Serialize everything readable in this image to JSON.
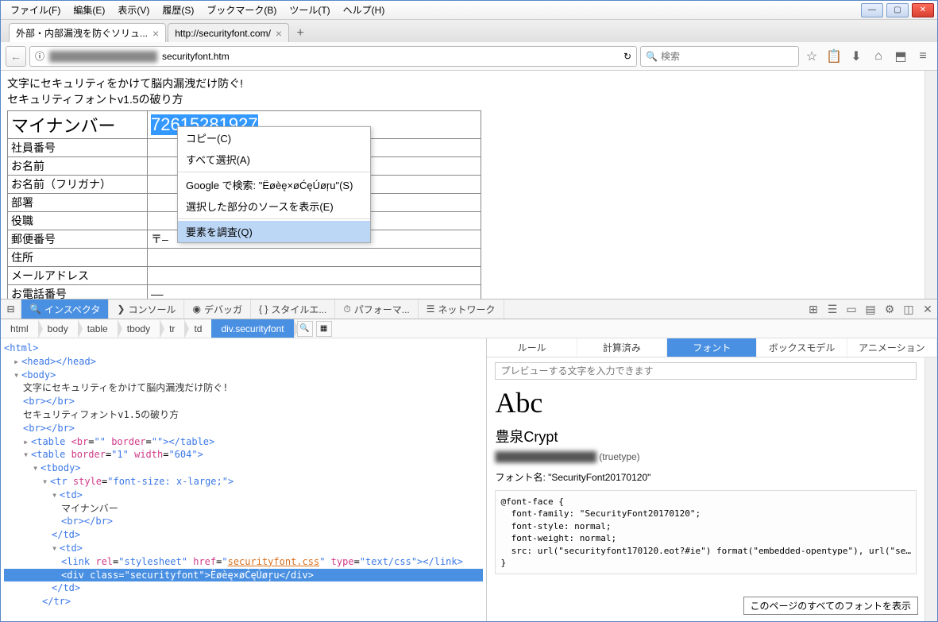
{
  "menubar": [
    "ファイル(F)",
    "編集(E)",
    "表示(V)",
    "履歴(S)",
    "ブックマーク(B)",
    "ツール(T)",
    "ヘルプ(H)"
  ],
  "winbtns": {
    "min": "—",
    "max": "▢",
    "close": "✕"
  },
  "tabs": [
    {
      "title": "外部・内部漏洩を防ぐソリュ...",
      "close": "×"
    },
    {
      "title": "http://securityfont.com/",
      "close": "×"
    }
  ],
  "tabadd": "+",
  "urlbar": {
    "back": "←",
    "info": "ⓘ",
    "blurred": "████████████████",
    "path": "securityfont.htm",
    "reload": "↻",
    "search_icon": "🔍",
    "search_ph": "検索",
    "icons": [
      "☆",
      "📋",
      "⬇",
      "⌂",
      "⬒",
      "≡"
    ]
  },
  "page": {
    "line1": "文字にセキュリティをかけて脳内漏洩だけ防ぐ!",
    "line2": "セキュリティフォントv1.5の破り方",
    "selected": "72615281927",
    "rows": [
      [
        "マイナンバー",
        ""
      ],
      [
        "社員番号",
        ""
      ],
      [
        "お名前",
        ""
      ],
      [
        "お名前（フリガナ）",
        ""
      ],
      [
        "部署",
        ""
      ],
      [
        "役職",
        ""
      ],
      [
        "郵便番号",
        "〒–"
      ],
      [
        "住所",
        ""
      ],
      [
        "メールアドレス",
        ""
      ],
      [
        "お電話番号",
        "––"
      ]
    ]
  },
  "ctx": [
    "コピー(C)",
    "すべて選択(A)",
    "",
    "Google で検索: \"Ëøèę×øĆęÚøŗu\"(S)",
    "選択した部分のソースを表示(E)",
    "",
    "要素を調査(Q)"
  ],
  "devtabs": [
    "インスペクタ",
    "コンソール",
    "デバッガ",
    "スタイルエ...",
    "パフォーマ...",
    "ネットワーク"
  ],
  "devicons": [
    "⊞",
    "☰",
    "▭",
    "▤",
    "⚙",
    "◫",
    "✕"
  ],
  "crumbs": [
    "html",
    "body",
    "table",
    "tbody",
    "tr",
    "td",
    "div.securityfont"
  ],
  "dom": {
    "html": "<html>",
    "head": "<head></head>",
    "body": "<body>",
    "txt1": "文字にセキュリティをかけて脳内漏洩だけ防ぐ!",
    "br": "<br></br>",
    "txt2": "セキュリティフォントv1.5の破り方",
    "table1": "<table <br=\"\" border=\"\"></table>",
    "table2_open": "<table",
    "table2_attr": " border=\"1\" width=\"604\">",
    "tbody": "<tbody>",
    "tr": "<tr style=\"font-size: x-large;\">",
    "td": "<td>",
    "txt3": "マイナンバー",
    "tdclose": "</td>",
    "link": "<link rel=\"stylesheet\" href=\"",
    "linkfile": "securityfont.css",
    "link2": "\" type=\"text/css\"></link>",
    "divline": "<div class=\"securityfont\">Ëøèę×øĆęÚøŗu</div>",
    "trclose": "</tr>"
  },
  "side": {
    "tabs": [
      "ルール",
      "計算済み",
      "フォント",
      "ボックスモデル",
      "アニメーション"
    ],
    "preview_ph": "プレビューする文字を入力できます",
    "abc": "Abc",
    "fontname": "豊泉Crypt",
    "truetype": "(truetype)",
    "fontlabel": "フォント名: \"SecurityFont20170120\"",
    "code": "@font-face {\n  font-family: \"SecurityFont20170120\";\n  font-style: normal;\n  font-weight: normal;\n  src: url(\"securityfont170120.eot?#ie\") format(\"embedded-opentype\"), url(\"se…\n}",
    "footer": "このページのすべてのフォントを表示"
  }
}
